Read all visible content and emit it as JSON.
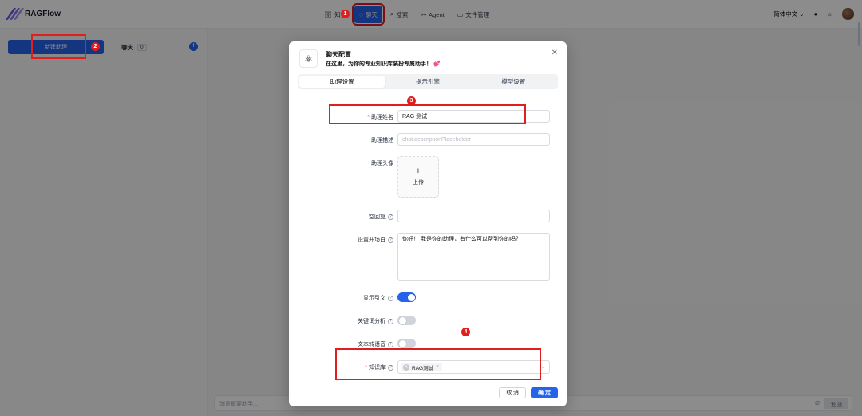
{
  "app": {
    "name": "RAGFlow"
  },
  "nav": {
    "items": [
      {
        "label": "知识库",
        "icon": "database-icon"
      },
      {
        "label": "聊天",
        "icon": "chat-icon",
        "active": true
      },
      {
        "label": "搜索",
        "icon": "search-icon"
      },
      {
        "label": "Agent",
        "icon": "agent-icon"
      },
      {
        "label": "文件管理",
        "icon": "folder-icon"
      }
    ],
    "visible_knowledge_label": "知识"
  },
  "header_right": {
    "language": "简体中文"
  },
  "sidebar": {
    "new_assistant_label": "新建助理"
  },
  "chat_list": {
    "title": "聊天",
    "count": "0"
  },
  "chat_input": {
    "placeholder": "消息概要助手...",
    "send_label": "发 送"
  },
  "modal": {
    "title": "聊天配置",
    "subtitle": "在这里，为你的专业知识库装扮专属助手！",
    "subtitle_emoji": "💕",
    "tabs": [
      "助理设置",
      "提示引擎",
      "模型设置"
    ],
    "active_tab": 0,
    "fields": {
      "name_label": "助理姓名",
      "name_value": "RAG 测试",
      "description_label": "助理描述",
      "description_placeholder": "chat.descriptionPlaceholder",
      "avatar_label": "助理头像",
      "upload_label": "上传",
      "empty_response_label": "空回复",
      "empty_response_value": "",
      "opener_label": "设置开场白",
      "opener_value": "你好！ 我是你的助理，有什么可以帮到你的吗？",
      "show_quote_label": "显示引文",
      "show_quote_on": true,
      "keyword_label": "关键词分析",
      "keyword_on": false,
      "tts_label": "文本转语音",
      "tts_on": false,
      "kb_label": "知识库",
      "kb_tag": "RAG测试",
      "kb_tag_avatar": "A"
    },
    "cancel_label": "取 消",
    "ok_label": "确 定"
  },
  "annotations": [
    "1",
    "2",
    "3",
    "4"
  ],
  "colors": {
    "accent": "#2563eb",
    "annotation": "#e11d1d"
  }
}
